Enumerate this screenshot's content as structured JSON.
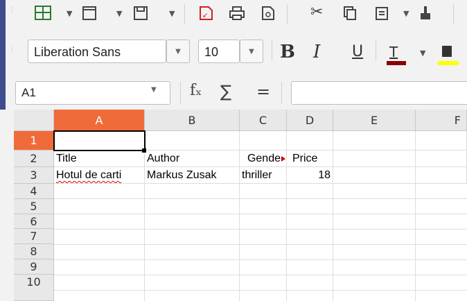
{
  "font": {
    "name": "Liberation Sans",
    "size": "10"
  },
  "namebox": {
    "value": "A1"
  },
  "formula": {
    "fx": "fₓ",
    "sum": "∑",
    "eq": "="
  },
  "format": {
    "bold": "B",
    "italic": "I",
    "underline": "U"
  },
  "colors": {
    "font_color": "#8b0000",
    "highlight": "#ffff00",
    "selected_header": "#f06b3a"
  },
  "columns": [
    "A",
    "B",
    "C",
    "D",
    "E",
    "F"
  ],
  "rows": [
    "1",
    "2",
    "3",
    "4",
    "5",
    "6",
    "7",
    "8",
    "9",
    "10"
  ],
  "cells": {
    "A2": "Title",
    "B2": "Author",
    "C2": "Gende",
    "D2": "Price",
    "A3": "Hotul de carti",
    "B3": "Markus Zusak",
    "C3": "thriller",
    "D3": "18"
  }
}
